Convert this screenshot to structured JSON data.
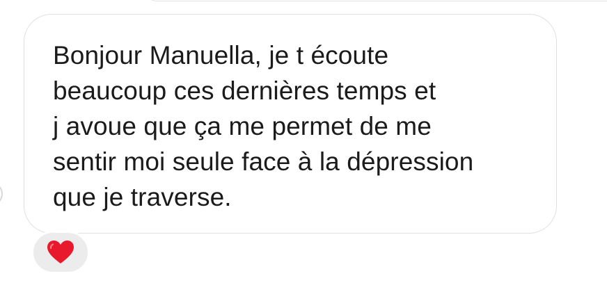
{
  "message": {
    "lines": [
      "Bonjour Manuella, je t écoute",
      "beaucoup ces dernières temps et",
      "j avoue que ça me permet de me",
      "sentir moi seule face à la dépression",
      "que je traverse."
    ]
  },
  "reaction": {
    "icon": "heart-icon",
    "color": "#e8192c"
  }
}
